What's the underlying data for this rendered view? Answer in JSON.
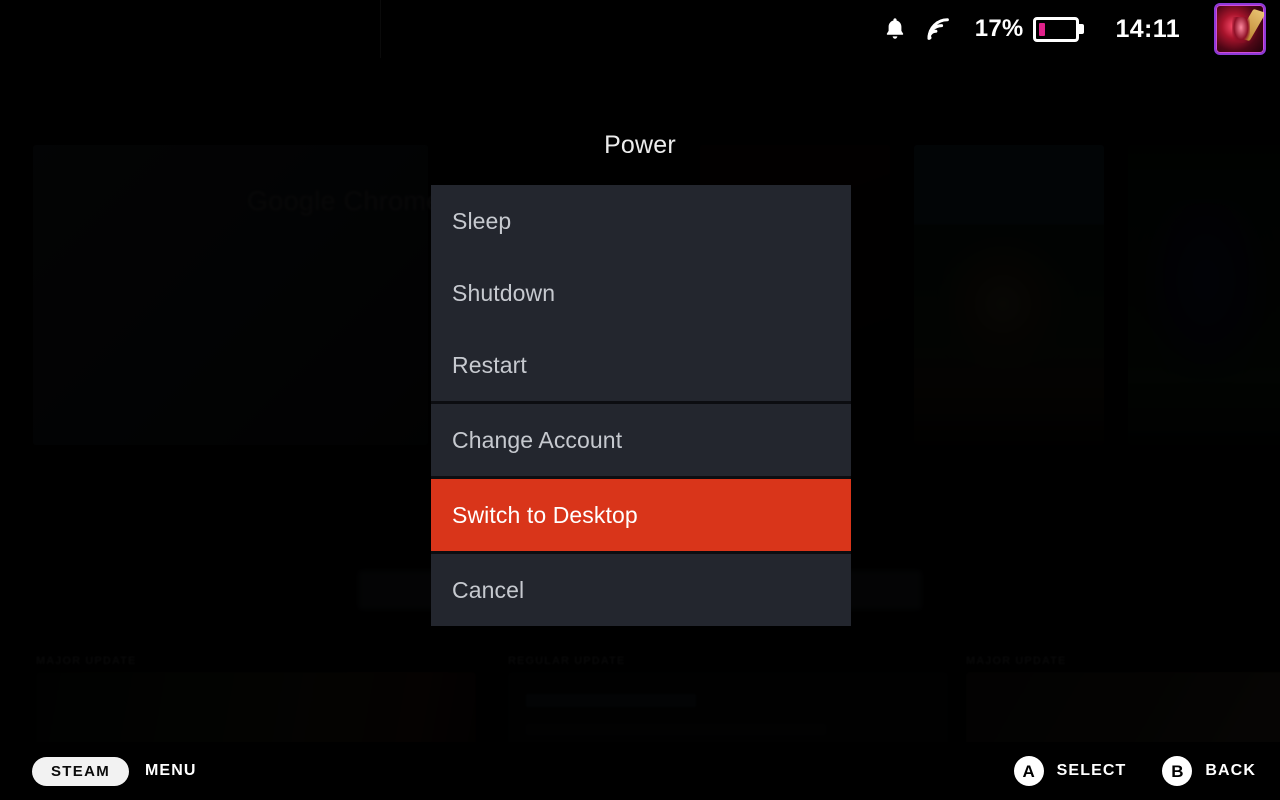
{
  "statusbar": {
    "notifications_icon": "bell-icon",
    "wifi_icon": "wifi-icon",
    "battery_percent_label": "17%",
    "battery_percent_value": 17,
    "battery_color": "#e0218a",
    "clock": "14:11",
    "avatar_label": "user-avatar"
  },
  "modal": {
    "title": "Power",
    "selected_index": 4,
    "highlight_color": "#d9351a",
    "panel_color": "#23262e",
    "groups": [
      {
        "items": [
          {
            "label": "Sleep"
          },
          {
            "label": "Shutdown"
          },
          {
            "label": "Restart"
          }
        ]
      },
      {
        "items": [
          {
            "label": "Change Account"
          }
        ]
      },
      {
        "items": [
          {
            "label": "Switch to Desktop",
            "selected": true
          }
        ]
      },
      {
        "items": [
          {
            "label": "Cancel"
          }
        ]
      }
    ]
  },
  "background": {
    "hero_title": "Google Chrome",
    "news_labels": [
      "MAJOR UPDATE",
      "REGULAR UPDATE",
      "MAJOR UPDATE"
    ]
  },
  "footer": {
    "steam_button": "STEAM",
    "menu_label": "MENU",
    "hints": [
      {
        "glyph": "A",
        "label": "SELECT"
      },
      {
        "glyph": "B",
        "label": "BACK"
      }
    ]
  }
}
